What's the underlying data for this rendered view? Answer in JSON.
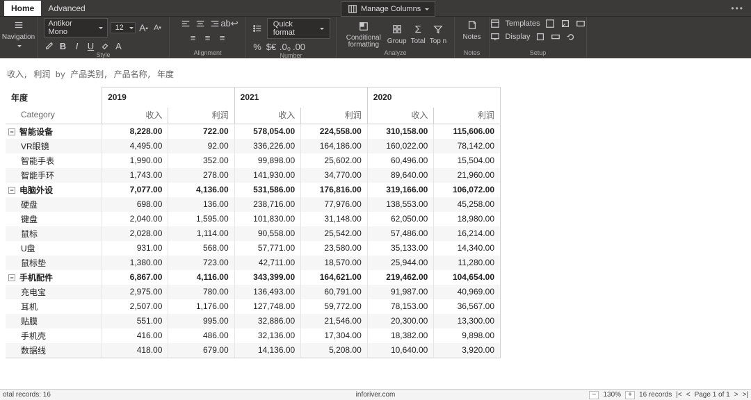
{
  "tabs": {
    "home": "Home",
    "advanced": "Advanced"
  },
  "manage_columns": "Manage Columns",
  "toolbar": {
    "navigation": "Navigation",
    "font": "Antikor Mono",
    "size": "12",
    "quick_format": "Quick format",
    "cond_fmt": "Conditional formatting",
    "group": "Group",
    "total": "Total",
    "topn": "Top n",
    "notes": "Notes",
    "templates": "Templates",
    "display": "Display",
    "g_style": "Style",
    "g_align": "Alignment",
    "g_number": "Number",
    "g_analyze": "Analyze",
    "g_notes": "Notes",
    "g_setup": "Setup"
  },
  "subtitle": "收入, 利润 by 产品类别, 产品名称, 年度",
  "year_label": "年度",
  "category_label": "Category",
  "years": [
    "2019",
    "2021",
    "2020"
  ],
  "measures": [
    "收入",
    "利润"
  ],
  "rows": [
    {
      "t": "c",
      "n": "智能设备",
      "v": [
        "8,228.00",
        "722.00",
        "578,054.00",
        "224,558.00",
        "310,158.00",
        "115,606.00"
      ]
    },
    {
      "t": "d",
      "n": "VR眼镜",
      "v": [
        "4,495.00",
        "92.00",
        "336,226.00",
        "164,186.00",
        "160,022.00",
        "78,142.00"
      ]
    },
    {
      "t": "d",
      "n": "智能手表",
      "v": [
        "1,990.00",
        "352.00",
        "99,898.00",
        "25,602.00",
        "60,496.00",
        "15,504.00"
      ]
    },
    {
      "t": "d",
      "n": "智能手环",
      "v": [
        "1,743.00",
        "278.00",
        "141,930.00",
        "34,770.00",
        "89,640.00",
        "21,960.00"
      ]
    },
    {
      "t": "c",
      "n": "电脑外设",
      "v": [
        "7,077.00",
        "4,136.00",
        "531,586.00",
        "176,816.00",
        "319,166.00",
        "106,072.00"
      ]
    },
    {
      "t": "d",
      "n": "硬盘",
      "v": [
        "698.00",
        "136.00",
        "238,716.00",
        "77,976.00",
        "138,553.00",
        "45,258.00"
      ]
    },
    {
      "t": "d",
      "n": "键盘",
      "v": [
        "2,040.00",
        "1,595.00",
        "101,830.00",
        "31,148.00",
        "62,050.00",
        "18,980.00"
      ]
    },
    {
      "t": "d",
      "n": "鼠标",
      "v": [
        "2,028.00",
        "1,114.00",
        "90,558.00",
        "25,542.00",
        "57,486.00",
        "16,214.00"
      ]
    },
    {
      "t": "d",
      "n": "U盘",
      "v": [
        "931.00",
        "568.00",
        "57,771.00",
        "23,580.00",
        "35,133.00",
        "14,340.00"
      ]
    },
    {
      "t": "d",
      "n": "鼠标垫",
      "v": [
        "1,380.00",
        "723.00",
        "42,711.00",
        "18,570.00",
        "25,944.00",
        "11,280.00"
      ]
    },
    {
      "t": "c",
      "n": "手机配件",
      "v": [
        "6,867.00",
        "4,116.00",
        "343,399.00",
        "164,621.00",
        "219,462.00",
        "104,654.00"
      ]
    },
    {
      "t": "d",
      "n": "充电宝",
      "v": [
        "2,975.00",
        "780.00",
        "136,493.00",
        "60,791.00",
        "91,987.00",
        "40,969.00"
      ]
    },
    {
      "t": "d",
      "n": "耳机",
      "v": [
        "2,507.00",
        "1,176.00",
        "127,748.00",
        "59,772.00",
        "78,153.00",
        "36,567.00"
      ]
    },
    {
      "t": "d",
      "n": "贴膜",
      "v": [
        "551.00",
        "995.00",
        "32,886.00",
        "21,546.00",
        "20,300.00",
        "13,300.00"
      ]
    },
    {
      "t": "d",
      "n": "手机壳",
      "v": [
        "416.00",
        "486.00",
        "32,136.00",
        "17,304.00",
        "18,382.00",
        "9,898.00"
      ]
    },
    {
      "t": "d",
      "n": "数据线",
      "v": [
        "418.00",
        "679.00",
        "14,136.00",
        "5,208.00",
        "10,640.00",
        "3,920.00"
      ]
    }
  ],
  "footer": {
    "total": "otal records: 16",
    "brand": "inforiver.com",
    "zoom": "130%",
    "records": "16 records",
    "page": "Page 1 of 1"
  }
}
